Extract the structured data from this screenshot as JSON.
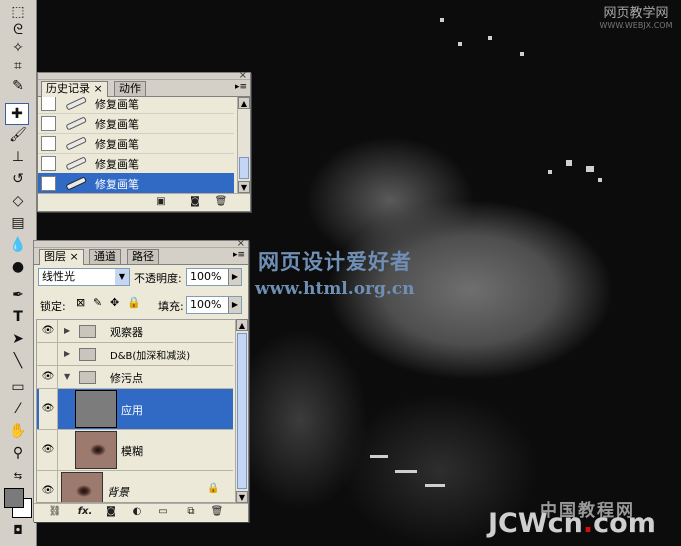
{
  "watermarks": {
    "top_right": "网页教学网",
    "top_right_url": "WWW.WEBJX.COM",
    "center_title": "网页设计爱好者",
    "center_url": "www.html.org.cn",
    "bottom_cn": "中国教程网",
    "bottom_logo_a": "JCWcn",
    "bottom_logo_dot": ".",
    "bottom_logo_b": "com"
  },
  "history_panel": {
    "tabs": [
      "历史记录",
      "动作"
    ],
    "items": [
      {
        "label": "修复画笔",
        "selected": false
      },
      {
        "label": "修复画笔",
        "selected": false
      },
      {
        "label": "修复画笔",
        "selected": false
      },
      {
        "label": "修复画笔",
        "selected": false
      },
      {
        "label": "修复画笔",
        "selected": true
      }
    ]
  },
  "layers_panel": {
    "tabs": [
      "图层",
      "通道",
      "路径"
    ],
    "blend_mode": "线性光",
    "opacity_label": "不透明度:",
    "opacity_value": "100%",
    "lock_label": "锁定:",
    "fill_label": "填充:",
    "fill_value": "100%",
    "layers": [
      {
        "name": "观察器",
        "type": "group",
        "visible": true,
        "expanded": false
      },
      {
        "name": "D&B(加深和减淡)",
        "type": "group",
        "visible": false,
        "expanded": false
      },
      {
        "name": "修污点",
        "type": "group",
        "visible": true,
        "expanded": true
      },
      {
        "name": "应用",
        "type": "layer",
        "visible": true,
        "selected": true
      },
      {
        "name": "模糊",
        "type": "layer",
        "visible": true,
        "selected": false
      },
      {
        "name": "背景",
        "type": "background",
        "visible": true,
        "locked": true
      }
    ],
    "footer_fx": "fx."
  },
  "colors": {
    "selection": "#316ac5",
    "panel_bg": "#ece9d8",
    "watermark_blue": "#6f8fb5"
  }
}
